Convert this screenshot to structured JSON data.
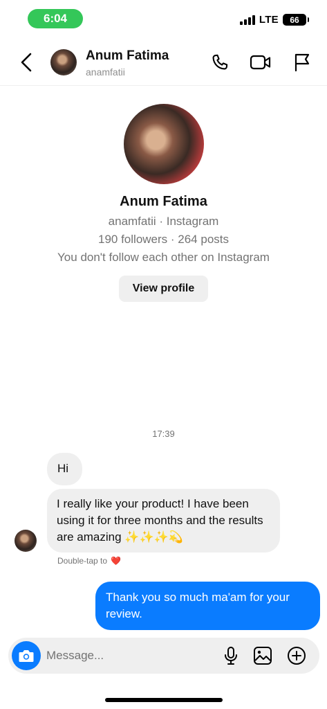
{
  "status_bar": {
    "time": "6:04",
    "network": "LTE",
    "battery": "66"
  },
  "header": {
    "name": "Anum Fatima",
    "username": "anamfatii"
  },
  "profile": {
    "name": "Anum Fatima",
    "handle_line": "anamfatii · Instagram",
    "stats_line": "190 followers · 264 posts",
    "follow_line": "You don't follow each other on Instagram",
    "view_profile_label": "View profile"
  },
  "conversation": {
    "timestamp": "17:39",
    "messages": [
      {
        "from": "them",
        "text": "Hi"
      },
      {
        "from": "them",
        "text": "I really like your product! I have been using it for three months and the results are amazing ✨✨✨💫"
      },
      {
        "from": "me",
        "text": "Thank you so much ma'am for your review."
      }
    ],
    "double_tap_hint": "Double-tap to",
    "double_tap_emoji": "❤️"
  },
  "composer": {
    "placeholder": "Message..."
  },
  "colors": {
    "accent_blue": "#0a7cff",
    "status_green": "#34c759",
    "bubble_gray": "#efefef",
    "muted_text": "#737373"
  },
  "icons": [
    "back-icon",
    "phone-icon",
    "video-icon",
    "flag-icon",
    "camera-icon",
    "microphone-icon",
    "gallery-icon",
    "add-icon",
    "heart-icon"
  ]
}
